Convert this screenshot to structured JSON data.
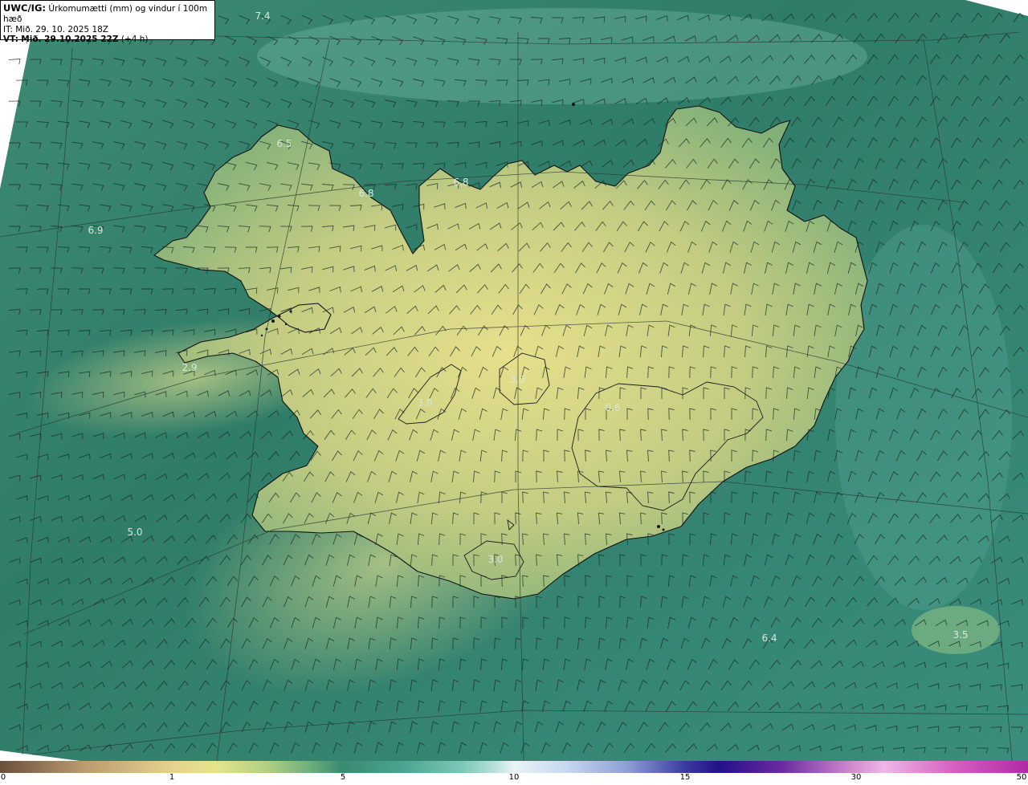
{
  "header": {
    "code": "UWC/IG:",
    "title": "Úrkomumætti (mm) og vindur í 100m hæð",
    "it_line": "IT: Mið. 29. 10. 2025 18Z",
    "vt_prefix": "VT:",
    "vt_value": "Mið. 29.10.2025 22Z",
    "vt_offset": "(+4 h)"
  },
  "map_labels": [
    {
      "text": "7.4"
    },
    {
      "text": "6.5"
    },
    {
      "text": "6.8"
    },
    {
      "text": "6.8"
    },
    {
      "text": "6.9"
    },
    {
      "text": "2.9"
    },
    {
      "text": "3.0"
    },
    {
      "text": "3.0"
    },
    {
      "text": "0.6"
    },
    {
      "text": "5.0"
    },
    {
      "text": "3.0"
    },
    {
      "text": "6.4"
    },
    {
      "text": "3.5"
    }
  ],
  "colorbar": {
    "ticks": [
      "0",
      "1",
      "5",
      "10",
      "15",
      "30",
      "50"
    ]
  },
  "colors": {
    "sea_dark": "#2f7a67",
    "sea_light": "#6fb3a3",
    "land_low": "#89b47a",
    "land_high": "#e4df8a",
    "coastline": "#111111",
    "barb": "#1a2a24"
  }
}
